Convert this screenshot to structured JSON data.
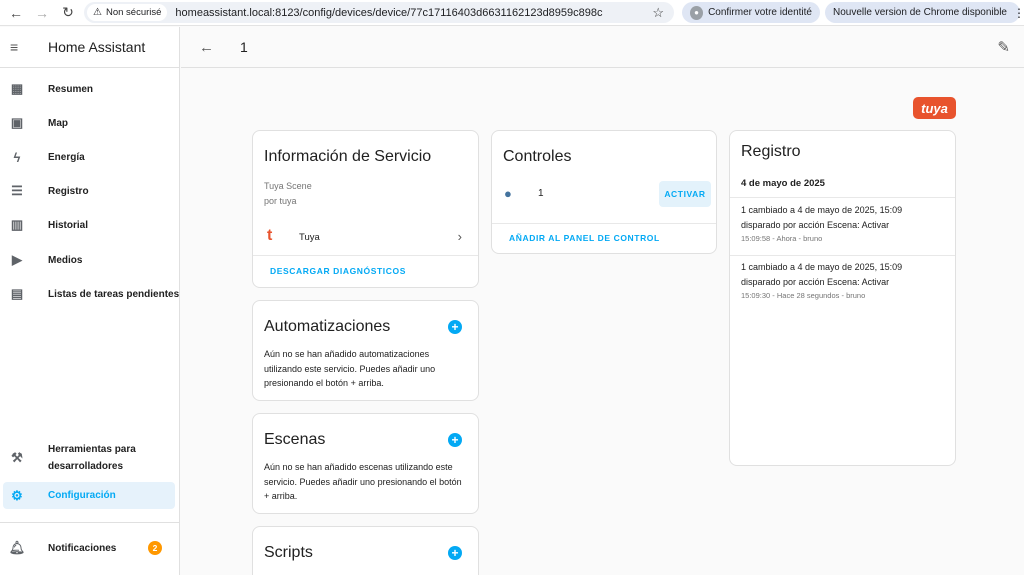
{
  "browser": {
    "security_label": "Non sécurisé",
    "url": "homeassistant.local:8123/config/devices/device/77c17116403d6631162123d8959c898c",
    "identity_label": "Confirmer votre identité",
    "update_label": "Nouvelle version de Chrome disponible"
  },
  "sidebar": {
    "title": "Home Assistant",
    "items": [
      {
        "label": "Resumen",
        "icon": "dashboard-icon"
      },
      {
        "label": "Map",
        "icon": "map-icon"
      },
      {
        "label": "Energía",
        "icon": "lightning-icon"
      },
      {
        "label": "Registro",
        "icon": "list-icon"
      },
      {
        "label": "Historial",
        "icon": "chart-icon"
      },
      {
        "label": "Medios",
        "icon": "media-icon"
      },
      {
        "label": "Listas de tareas pendientes",
        "icon": "clipboard-icon"
      }
    ],
    "dev_tools_line1": "Herramientas para",
    "dev_tools_line2": "desarrolladores",
    "config_label": "Configuración",
    "notifications_label": "Notificaciones",
    "notifications_count": "2"
  },
  "header": {
    "title": "1"
  },
  "brand": {
    "logo_text": "tuya",
    "accent": "#03a9f4",
    "tuya_color": "#e8532d"
  },
  "service_info": {
    "title": "Información de Servicio",
    "model": "Tuya Scene",
    "by": "por tuya",
    "integration": "Tuya",
    "download": "DESCARGAR DIAGNÓSTICOS"
  },
  "automations": {
    "title": "Automatizaciones",
    "text": "Aún no se han añadido automatizaciones utilizando este servicio. Puedes añadir uno presionando el botón + arriba."
  },
  "scenes": {
    "title": "Escenas",
    "text": "Aún no se han añadido escenas utilizando este servicio. Puedes añadir uno presionando el botón + arriba."
  },
  "scripts": {
    "title": "Scripts"
  },
  "controls": {
    "title": "Controles",
    "entity_name": "1",
    "activate": "ACTIVAR",
    "add_to_dashboard": "AÑADIR AL PANEL DE CONTROL"
  },
  "logbook": {
    "title": "Registro",
    "date": "4 de mayo de 2025",
    "entries": [
      {
        "line1": "1 cambiado a 4 de mayo de 2025, 15:09",
        "line2": "disparado por acción Escena: Activar",
        "meta": "15:09:58 - Ahora - bruno"
      },
      {
        "line1": "1 cambiado a 4 de mayo de 2025, 15:09",
        "line2": "disparado por acción Escena: Activar",
        "meta": "15:09:30 - Hace 28 segundos - bruno"
      }
    ]
  }
}
